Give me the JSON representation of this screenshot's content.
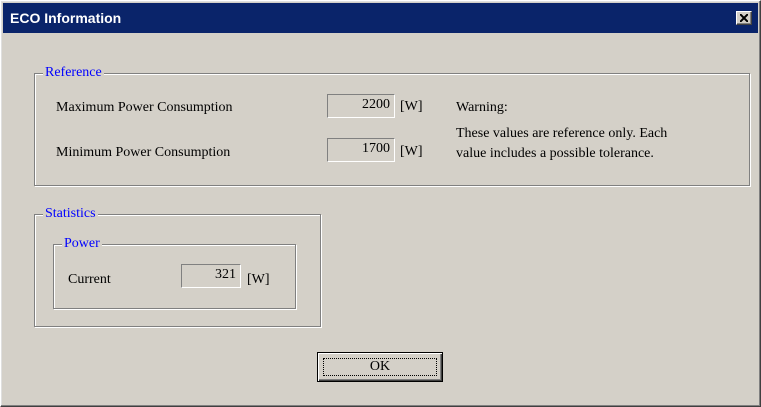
{
  "window": {
    "title": "ECO Information",
    "close_glyph": "close-icon"
  },
  "reference": {
    "legend": "Reference",
    "max_label": "Maximum Power Consumption",
    "max_value": "2200",
    "max_unit": "[W]",
    "min_label": "Minimum Power Consumption",
    "min_value": "1700",
    "min_unit": "[W]",
    "warning_title": "Warning:",
    "warning_line1": "These values are reference only. Each",
    "warning_line2": "value includes a possible tolerance."
  },
  "statistics": {
    "legend": "Statistics",
    "power": {
      "legend": "Power",
      "current_label": "Current",
      "current_value": "321",
      "current_unit": "[W]"
    }
  },
  "buttons": {
    "ok_label": "OK"
  },
  "colors": {
    "titlebar": "#0a246a",
    "legend_text": "#0000ff",
    "face": "#d4d0c8"
  }
}
